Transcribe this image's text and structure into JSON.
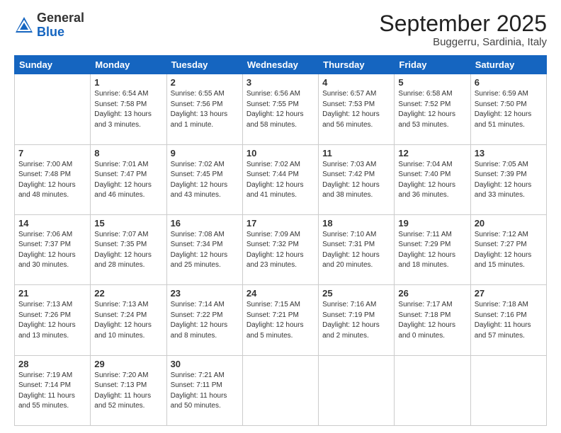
{
  "logo": {
    "general": "General",
    "blue": "Blue"
  },
  "header": {
    "month": "September 2025",
    "location": "Buggerru, Sardinia, Italy"
  },
  "days_of_week": [
    "Sunday",
    "Monday",
    "Tuesday",
    "Wednesday",
    "Thursday",
    "Friday",
    "Saturday"
  ],
  "weeks": [
    [
      {
        "day": "",
        "info": ""
      },
      {
        "day": "1",
        "info": "Sunrise: 6:54 AM\nSunset: 7:58 PM\nDaylight: 13 hours\nand 3 minutes."
      },
      {
        "day": "2",
        "info": "Sunrise: 6:55 AM\nSunset: 7:56 PM\nDaylight: 13 hours\nand 1 minute."
      },
      {
        "day": "3",
        "info": "Sunrise: 6:56 AM\nSunset: 7:55 PM\nDaylight: 12 hours\nand 58 minutes."
      },
      {
        "day": "4",
        "info": "Sunrise: 6:57 AM\nSunset: 7:53 PM\nDaylight: 12 hours\nand 56 minutes."
      },
      {
        "day": "5",
        "info": "Sunrise: 6:58 AM\nSunset: 7:52 PM\nDaylight: 12 hours\nand 53 minutes."
      },
      {
        "day": "6",
        "info": "Sunrise: 6:59 AM\nSunset: 7:50 PM\nDaylight: 12 hours\nand 51 minutes."
      }
    ],
    [
      {
        "day": "7",
        "info": "Sunrise: 7:00 AM\nSunset: 7:48 PM\nDaylight: 12 hours\nand 48 minutes."
      },
      {
        "day": "8",
        "info": "Sunrise: 7:01 AM\nSunset: 7:47 PM\nDaylight: 12 hours\nand 46 minutes."
      },
      {
        "day": "9",
        "info": "Sunrise: 7:02 AM\nSunset: 7:45 PM\nDaylight: 12 hours\nand 43 minutes."
      },
      {
        "day": "10",
        "info": "Sunrise: 7:02 AM\nSunset: 7:44 PM\nDaylight: 12 hours\nand 41 minutes."
      },
      {
        "day": "11",
        "info": "Sunrise: 7:03 AM\nSunset: 7:42 PM\nDaylight: 12 hours\nand 38 minutes."
      },
      {
        "day": "12",
        "info": "Sunrise: 7:04 AM\nSunset: 7:40 PM\nDaylight: 12 hours\nand 36 minutes."
      },
      {
        "day": "13",
        "info": "Sunrise: 7:05 AM\nSunset: 7:39 PM\nDaylight: 12 hours\nand 33 minutes."
      }
    ],
    [
      {
        "day": "14",
        "info": "Sunrise: 7:06 AM\nSunset: 7:37 PM\nDaylight: 12 hours\nand 30 minutes."
      },
      {
        "day": "15",
        "info": "Sunrise: 7:07 AM\nSunset: 7:35 PM\nDaylight: 12 hours\nand 28 minutes."
      },
      {
        "day": "16",
        "info": "Sunrise: 7:08 AM\nSunset: 7:34 PM\nDaylight: 12 hours\nand 25 minutes."
      },
      {
        "day": "17",
        "info": "Sunrise: 7:09 AM\nSunset: 7:32 PM\nDaylight: 12 hours\nand 23 minutes."
      },
      {
        "day": "18",
        "info": "Sunrise: 7:10 AM\nSunset: 7:31 PM\nDaylight: 12 hours\nand 20 minutes."
      },
      {
        "day": "19",
        "info": "Sunrise: 7:11 AM\nSunset: 7:29 PM\nDaylight: 12 hours\nand 18 minutes."
      },
      {
        "day": "20",
        "info": "Sunrise: 7:12 AM\nSunset: 7:27 PM\nDaylight: 12 hours\nand 15 minutes."
      }
    ],
    [
      {
        "day": "21",
        "info": "Sunrise: 7:13 AM\nSunset: 7:26 PM\nDaylight: 12 hours\nand 13 minutes."
      },
      {
        "day": "22",
        "info": "Sunrise: 7:13 AM\nSunset: 7:24 PM\nDaylight: 12 hours\nand 10 minutes."
      },
      {
        "day": "23",
        "info": "Sunrise: 7:14 AM\nSunset: 7:22 PM\nDaylight: 12 hours\nand 8 minutes."
      },
      {
        "day": "24",
        "info": "Sunrise: 7:15 AM\nSunset: 7:21 PM\nDaylight: 12 hours\nand 5 minutes."
      },
      {
        "day": "25",
        "info": "Sunrise: 7:16 AM\nSunset: 7:19 PM\nDaylight: 12 hours\nand 2 minutes."
      },
      {
        "day": "26",
        "info": "Sunrise: 7:17 AM\nSunset: 7:18 PM\nDaylight: 12 hours\nand 0 minutes."
      },
      {
        "day": "27",
        "info": "Sunrise: 7:18 AM\nSunset: 7:16 PM\nDaylight: 11 hours\nand 57 minutes."
      }
    ],
    [
      {
        "day": "28",
        "info": "Sunrise: 7:19 AM\nSunset: 7:14 PM\nDaylight: 11 hours\nand 55 minutes."
      },
      {
        "day": "29",
        "info": "Sunrise: 7:20 AM\nSunset: 7:13 PM\nDaylight: 11 hours\nand 52 minutes."
      },
      {
        "day": "30",
        "info": "Sunrise: 7:21 AM\nSunset: 7:11 PM\nDaylight: 11 hours\nand 50 minutes."
      },
      {
        "day": "",
        "info": ""
      },
      {
        "day": "",
        "info": ""
      },
      {
        "day": "",
        "info": ""
      },
      {
        "day": "",
        "info": ""
      }
    ]
  ]
}
